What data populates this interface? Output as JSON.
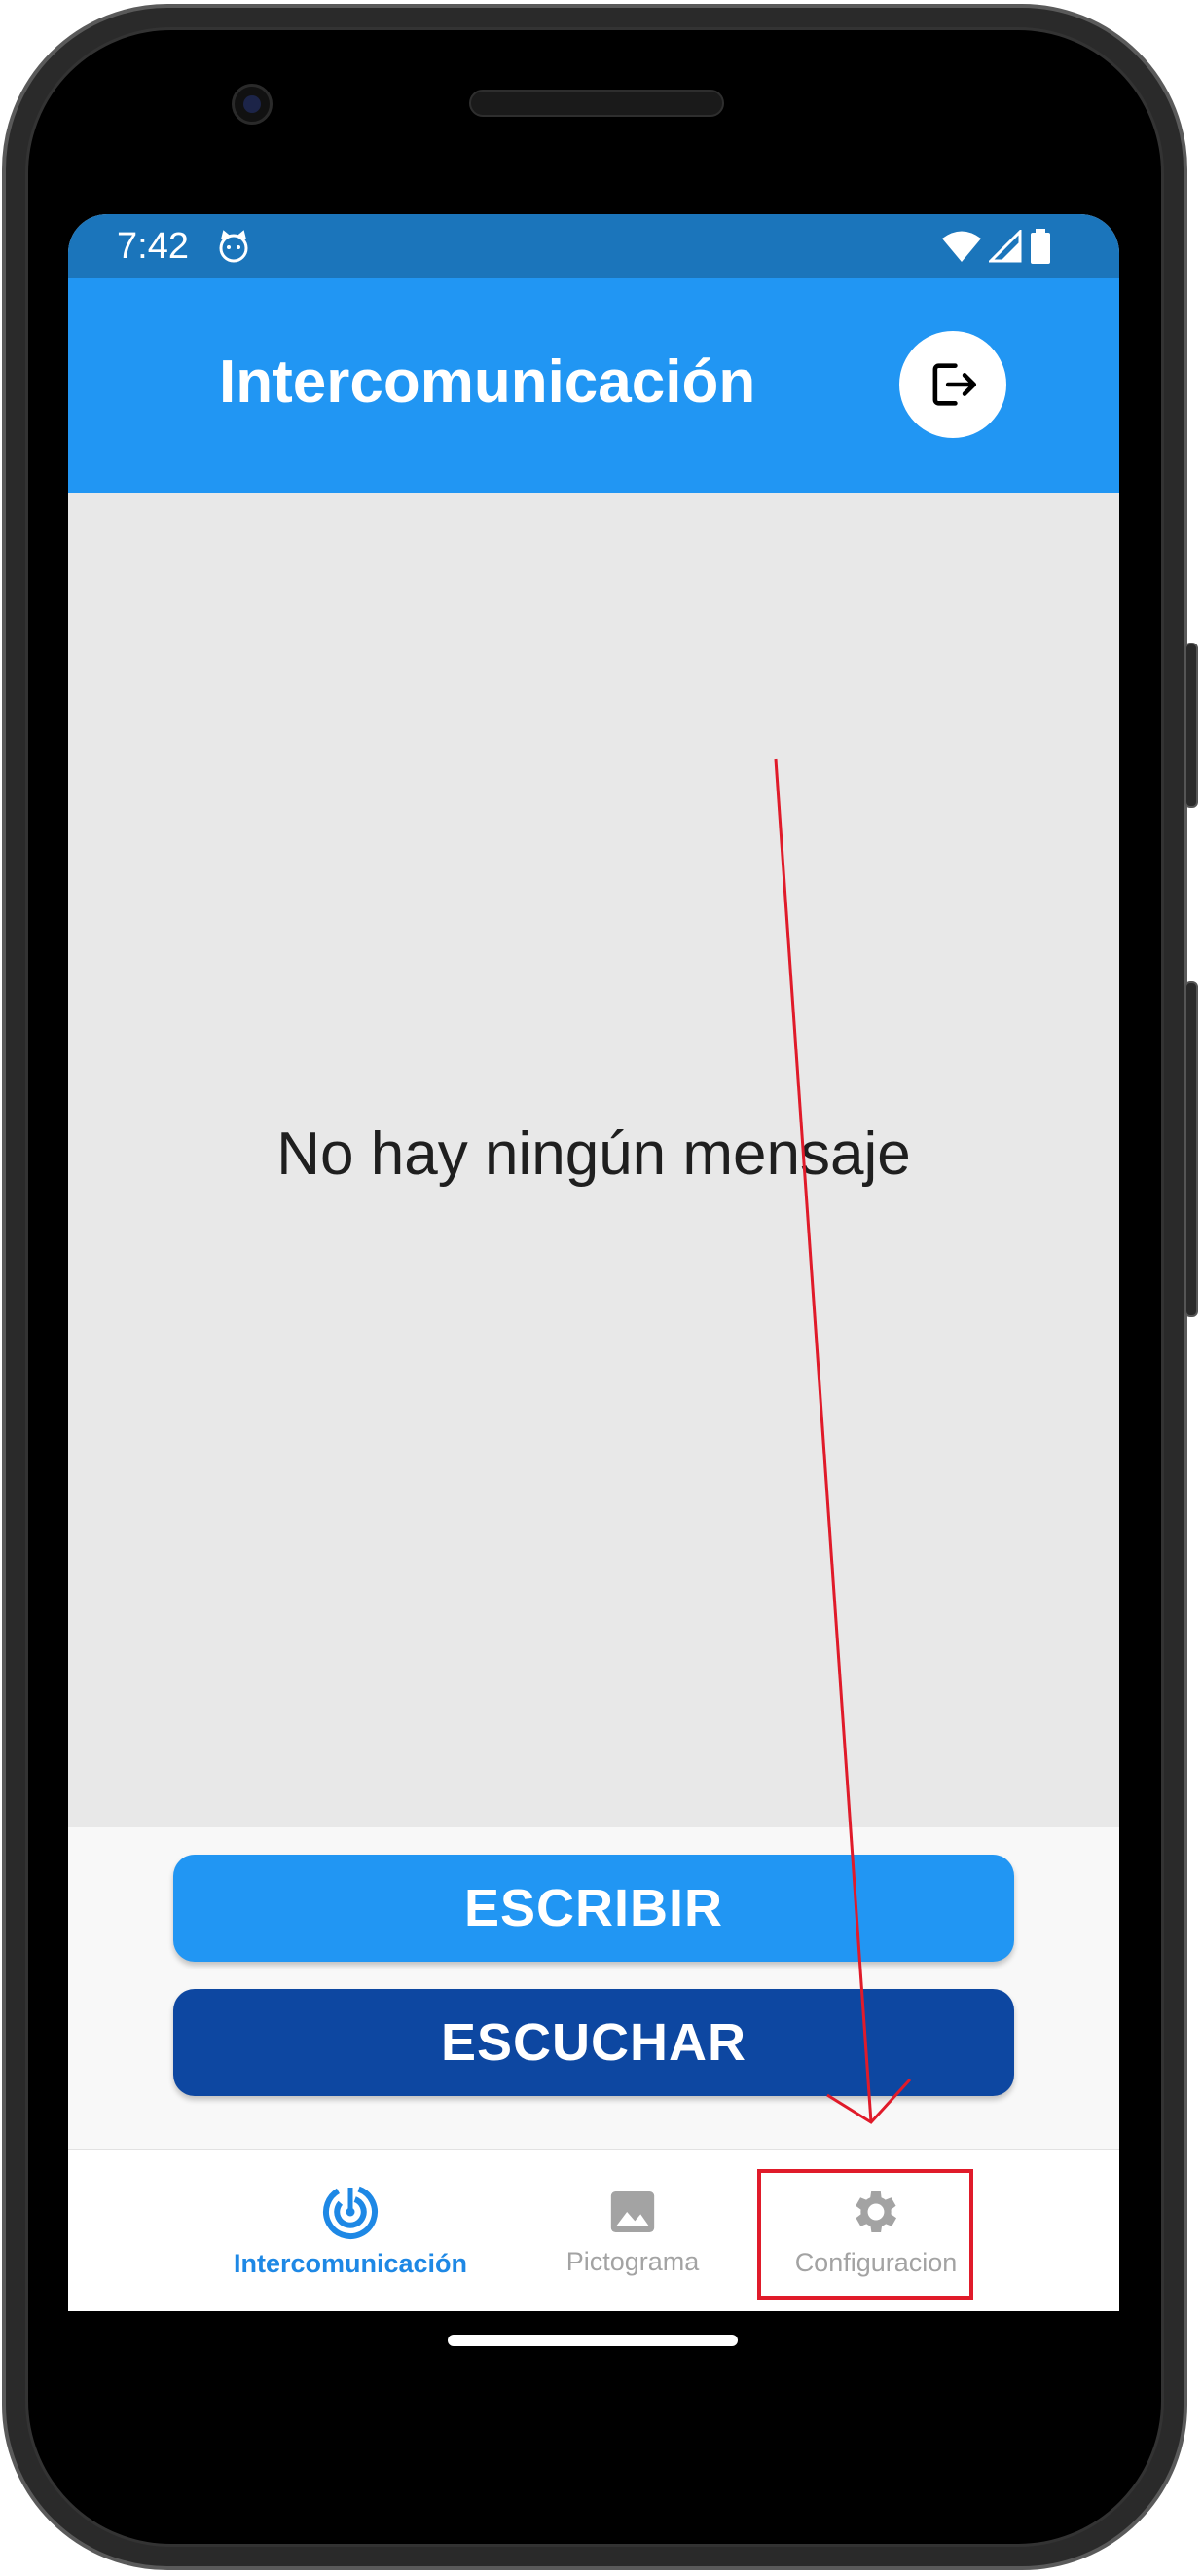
{
  "status_bar": {
    "time": "7:42",
    "icons": [
      "cat-notification-icon",
      "wifi-icon",
      "cell-signal-icon",
      "battery-icon"
    ]
  },
  "app_bar": {
    "title": "Intercomunicación",
    "logout_icon": "logout-icon"
  },
  "main": {
    "empty_message": "No hay ningún mensaje"
  },
  "actions": {
    "write_label": "ESCRIBIR",
    "listen_label": "ESCUCHAR"
  },
  "bottom_nav": {
    "items": [
      {
        "label": "Intercomunicación",
        "icon": "radar-icon",
        "active": true
      },
      {
        "label": "Pictograma",
        "icon": "image-icon",
        "active": false
      },
      {
        "label": "Configuracion",
        "icon": "gear-icon",
        "active": false
      }
    ]
  },
  "colors": {
    "status_bar": "#1b75bb",
    "app_bar": "#2196f3",
    "write_button": "#2196f3",
    "listen_button": "#0d47a1",
    "nav_active": "#1e88e5",
    "nav_inactive": "#a3a3a3",
    "annotation": "#e01b2a"
  }
}
